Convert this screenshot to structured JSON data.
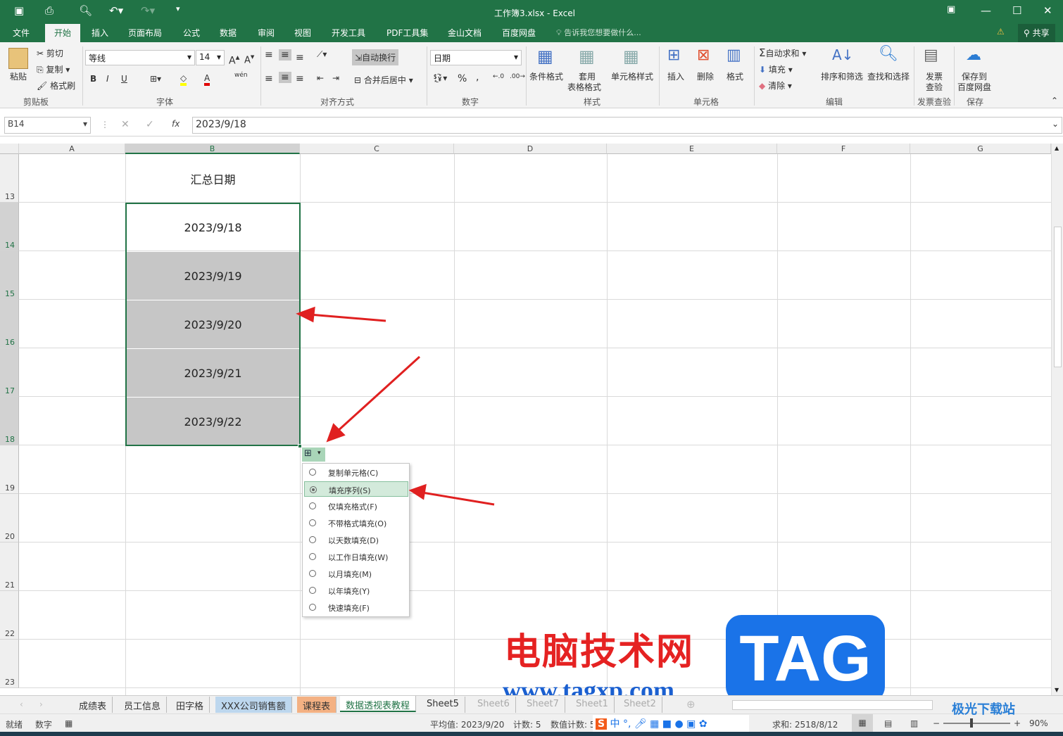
{
  "window": {
    "title": "工作簿3.xlsx - Excel",
    "share": "共享",
    "search_hint": "告诉我您想要做什么..."
  },
  "menu": [
    "文件",
    "开始",
    "插入",
    "页面布局",
    "公式",
    "数据",
    "审阅",
    "视图",
    "开发工具",
    "PDF工具集",
    "金山文档",
    "百度网盘"
  ],
  "ribbon": {
    "clipboard": {
      "paste": "粘贴",
      "cut": "剪切",
      "copy": "复制",
      "format_painter": "格式刷",
      "label": "剪贴板"
    },
    "font": {
      "name": "等线",
      "size": "14",
      "bold": "B",
      "italic": "I",
      "underline": "U",
      "label": "字体",
      "phonetic": "wén"
    },
    "alignment": {
      "wrap": "自动换行",
      "merge": "合并后居中",
      "label": "对齐方式"
    },
    "number": {
      "format": "日期",
      "percent": "%",
      "comma": ",",
      "label": "数字"
    },
    "styles": {
      "conditional": "条件格式",
      "table_format_1": "套用",
      "table_format_2": "表格格式",
      "cell_styles": "单元格样式",
      "label": "样式"
    },
    "cells": {
      "insert": "插入",
      "delete": "删除",
      "format": "格式",
      "label": "单元格"
    },
    "editing": {
      "autosum": "自动求和",
      "fill": "填充",
      "clear": "清除",
      "sort_filter": "排序和筛选",
      "find_select": "查找和选择",
      "label": "编辑"
    },
    "invoice": {
      "check_1": "发票",
      "check_2": "查验",
      "label": "发票查验"
    },
    "save": {
      "save_1": "保存到",
      "save_2": "百度网盘",
      "label": "保存"
    }
  },
  "formula_bar": {
    "name_box": "B14",
    "value": "2023/9/18",
    "fx": "fx"
  },
  "columns": [
    "A",
    "B",
    "C",
    "D",
    "E",
    "F",
    "G"
  ],
  "rows": [
    "13",
    "14",
    "15",
    "16",
    "17",
    "18",
    "19",
    "20",
    "21",
    "22",
    "23"
  ],
  "cells": {
    "header": "汇总日期",
    "dates": [
      "2023/9/18",
      "2023/9/19",
      "2023/9/20",
      "2023/9/21",
      "2023/9/22"
    ]
  },
  "autofill_menu": {
    "selected": "填充序列(S)",
    "options": [
      "复制单元格(C)",
      "填充序列(S)",
      "仅填充格式(F)",
      "不带格式填充(O)",
      "以天数填充(D)",
      "以工作日填充(W)",
      "以月填充(M)",
      "以年填充(Y)",
      "快速填充(F)"
    ]
  },
  "sheets": [
    "成绩表",
    "员工信息",
    "田字格",
    "XXX公司销售额",
    "课程表",
    "数据透视表教程",
    "Sheet5",
    "Sheet6",
    "Sheet7",
    "Sheet1",
    "Sheet2"
  ],
  "active_sheet": "数据透视表教程",
  "status": {
    "ready": "就绪",
    "mode": "数字",
    "average": "平均值: 2023/9/20",
    "count": "计数: 5",
    "numcount": "数值计数: 5",
    "sum": "求和: 2518/8/12",
    "zoom": "90%"
  },
  "watermark": {
    "site_cn": "电脑技术网",
    "tag": "TAG",
    "url": "www.tagxp.com",
    "corner": "极光下载站"
  },
  "colors": {
    "excel_green": "#217346",
    "selection_shade": "#c6c6c6",
    "arrow": "#e02020",
    "tag_blue": "#1a73e8",
    "watermark_red": "#e52222"
  }
}
